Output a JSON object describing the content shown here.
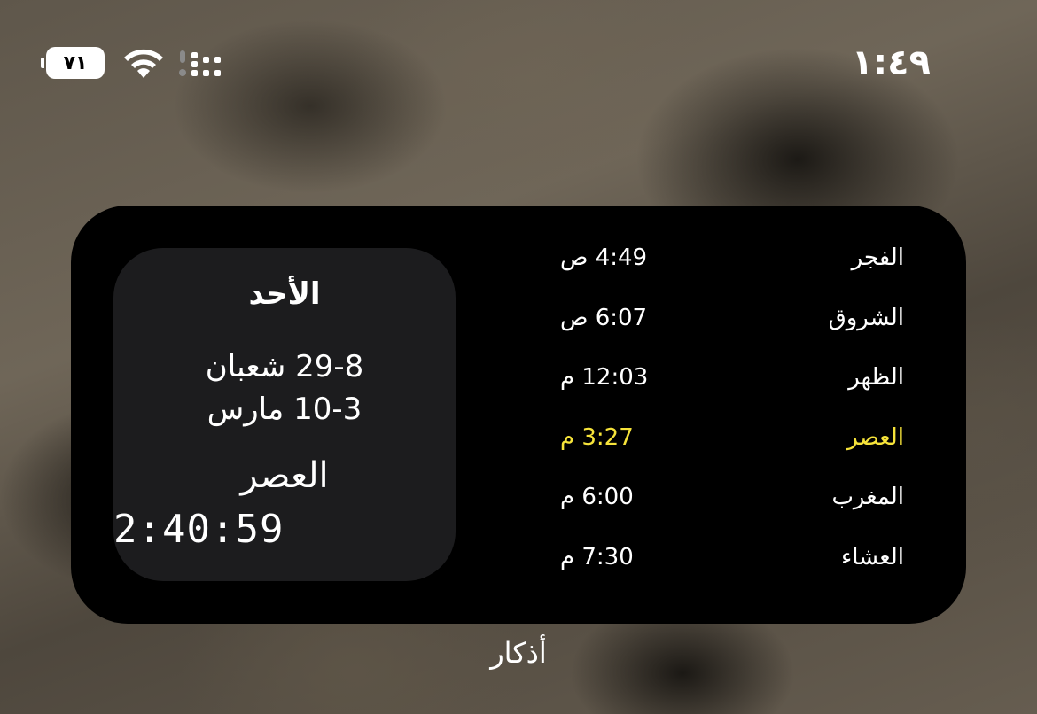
{
  "status_bar": {
    "time": "١:٤٩",
    "battery": "٧١",
    "icons": [
      "battery-icon",
      "wifi-icon",
      "cellular-signal-icon"
    ]
  },
  "widget": {
    "date_card": {
      "day": "الأحد",
      "hijri": "29-8 شعبان",
      "gregorian": "10-3 مارس",
      "next_prayer": "العصر",
      "countdown": "2:40:59"
    },
    "prayers": [
      {
        "name": "الفجر",
        "time": "4:49 ص",
        "active": false
      },
      {
        "name": "الشروق",
        "time": "6:07 ص",
        "active": false
      },
      {
        "name": "الظهر",
        "time": "12:03 م",
        "active": false
      },
      {
        "name": "العصر",
        "time": "3:27 م",
        "active": true
      },
      {
        "name": "المغرب",
        "time": "6:00 م",
        "active": false
      },
      {
        "name": "العشاء",
        "time": "7:30 م",
        "active": false
      }
    ],
    "active_color": "#f6e33a"
  },
  "widget_label": "أذكار"
}
